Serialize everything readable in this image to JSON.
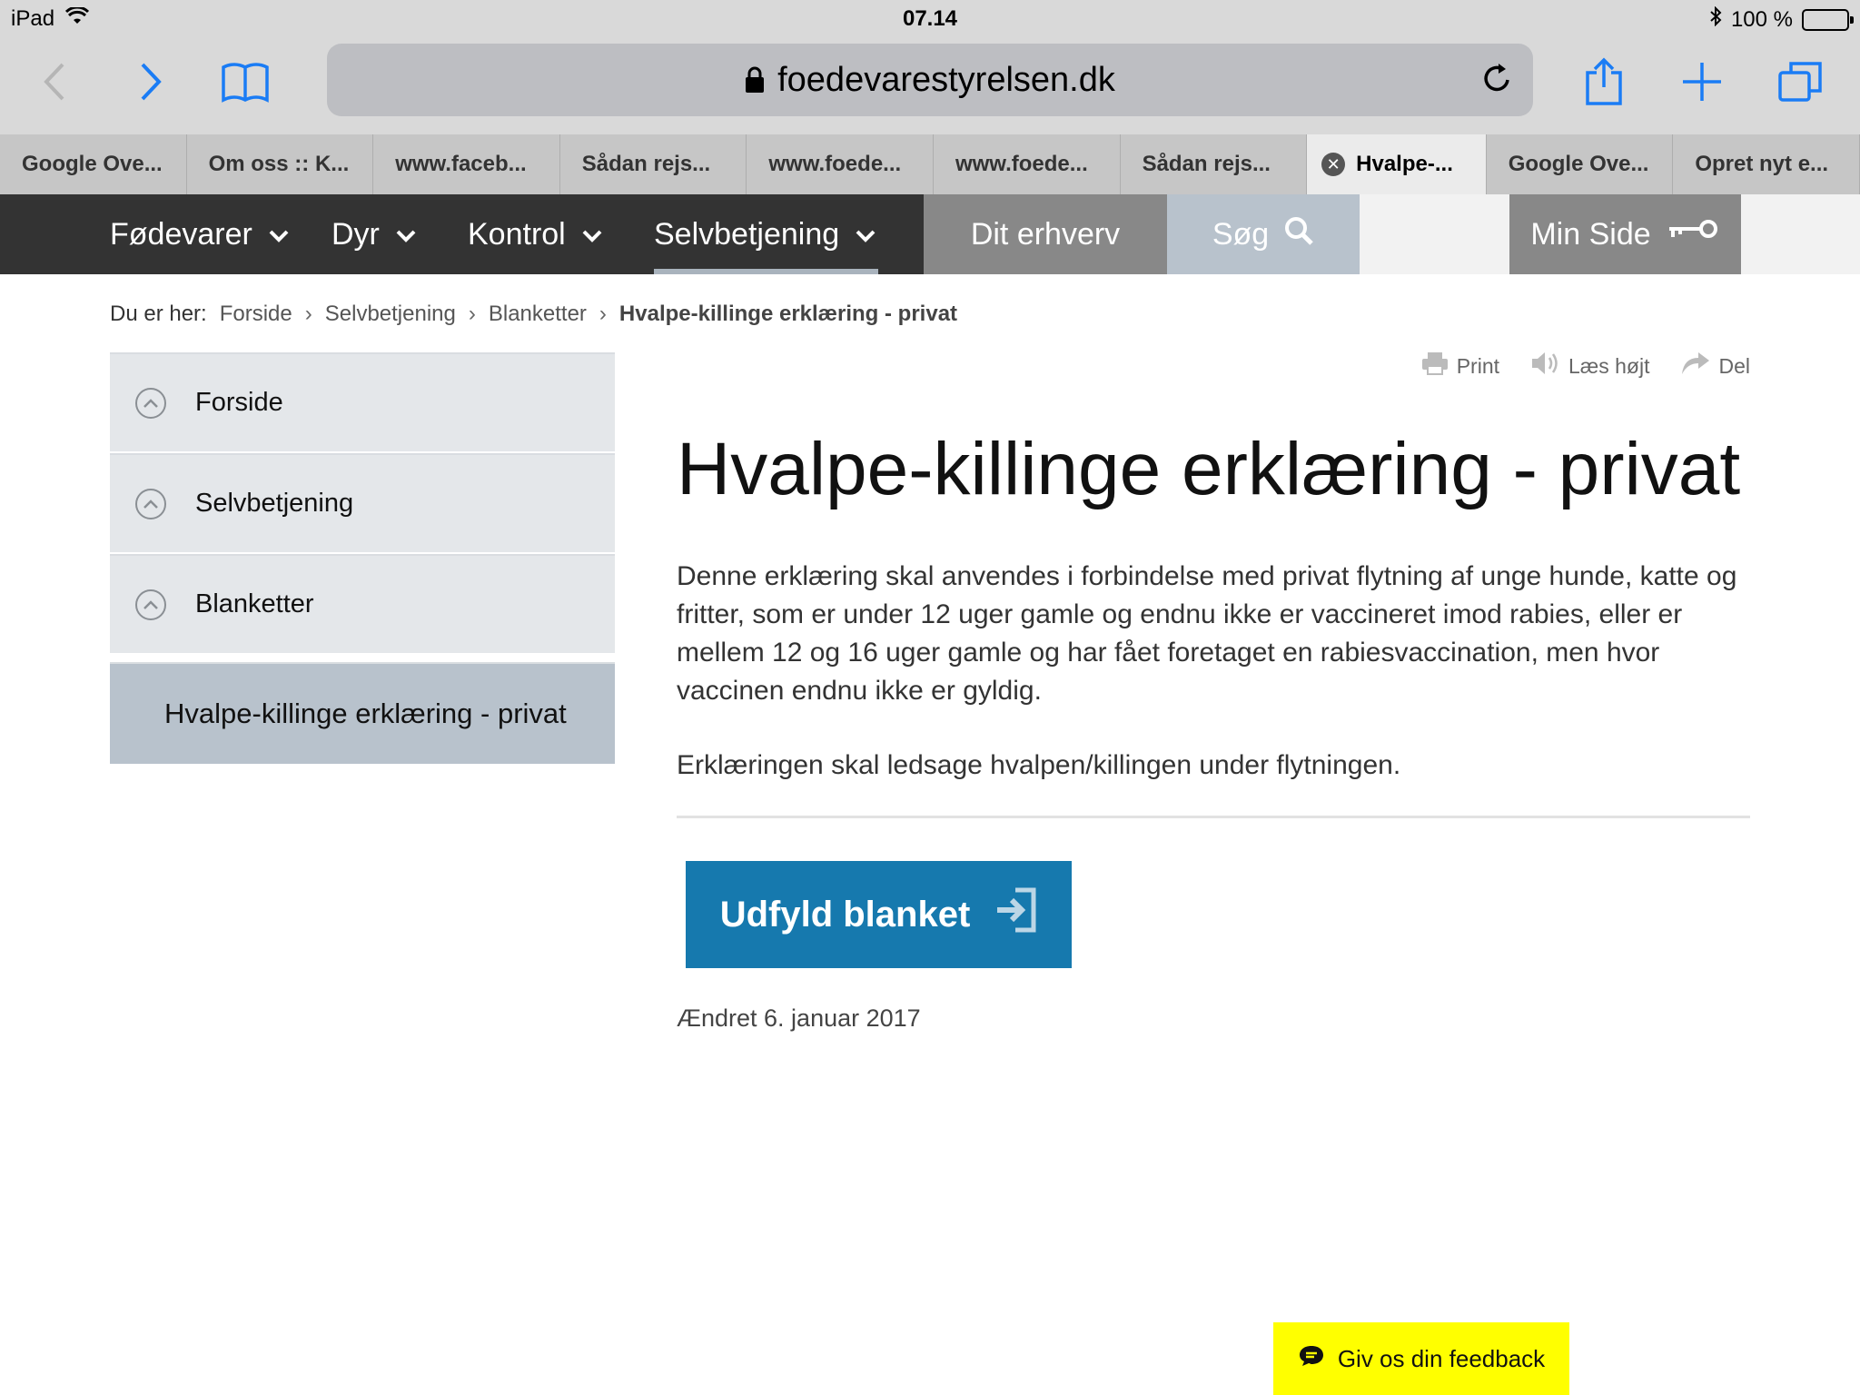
{
  "status_bar": {
    "device": "iPad",
    "time": "07.14",
    "battery": "100 %"
  },
  "browser": {
    "url": "foedevarestyrelsen.dk",
    "tabs": [
      {
        "label": "Google Ove..."
      },
      {
        "label": "Om oss :: K..."
      },
      {
        "label": "www.faceb..."
      },
      {
        "label": "Sådan rejs..."
      },
      {
        "label": "www.foede..."
      },
      {
        "label": "www.foede..."
      },
      {
        "label": "Sådan rejs..."
      },
      {
        "label": "Hvalpe-..."
      },
      {
        "label": "Google Ove..."
      },
      {
        "label": "Opret nyt e..."
      }
    ]
  },
  "site_nav": {
    "items": [
      {
        "label": "Fødevarer"
      },
      {
        "label": "Dyr"
      },
      {
        "label": "Kontrol"
      },
      {
        "label": "Selvbetjening"
      }
    ],
    "dit_erhverv": "Dit erhverv",
    "search": "Søg",
    "min_side": "Min Side"
  },
  "breadcrumb": {
    "prefix": "Du er her:",
    "items": [
      "Forside",
      "Selvbetjening",
      "Blanketter"
    ],
    "current": "Hvalpe-killinge erklæring - privat"
  },
  "sidebar": {
    "items": [
      {
        "label": "Forside"
      },
      {
        "label": "Selvbetjening"
      },
      {
        "label": "Blanketter"
      }
    ],
    "active": "Hvalpe-killinge erklæring - privat"
  },
  "tools": {
    "print": "Print",
    "read_aloud": "Læs højt",
    "share": "Del"
  },
  "content": {
    "title": "Hvalpe-killinge erklæring - privat",
    "intro": "Denne erklæring skal anvendes i forbindelse med privat flytning af unge hunde, katte og fritter, som er under 12 uger gamle og endnu ikke er vaccineret imod rabies, eller er mellem 12 og 16 uger gamle og har fået foretaget en rabiesvaccination, men hvor vaccinen endnu ikke er gyldig.",
    "note": "Erklæringen skal ledsage hvalpen/killingen under flytningen.",
    "cta": "Udfyld blanket",
    "changed": "Ændret 6. januar 2017"
  },
  "feedback": "Giv os din feedback",
  "colors": {
    "nav_dark": "#333333",
    "nav_grey": "#888888",
    "search_bg": "#b8c2cc",
    "cta_blue": "#1679ae",
    "feedback_yellow": "#ffff00"
  }
}
